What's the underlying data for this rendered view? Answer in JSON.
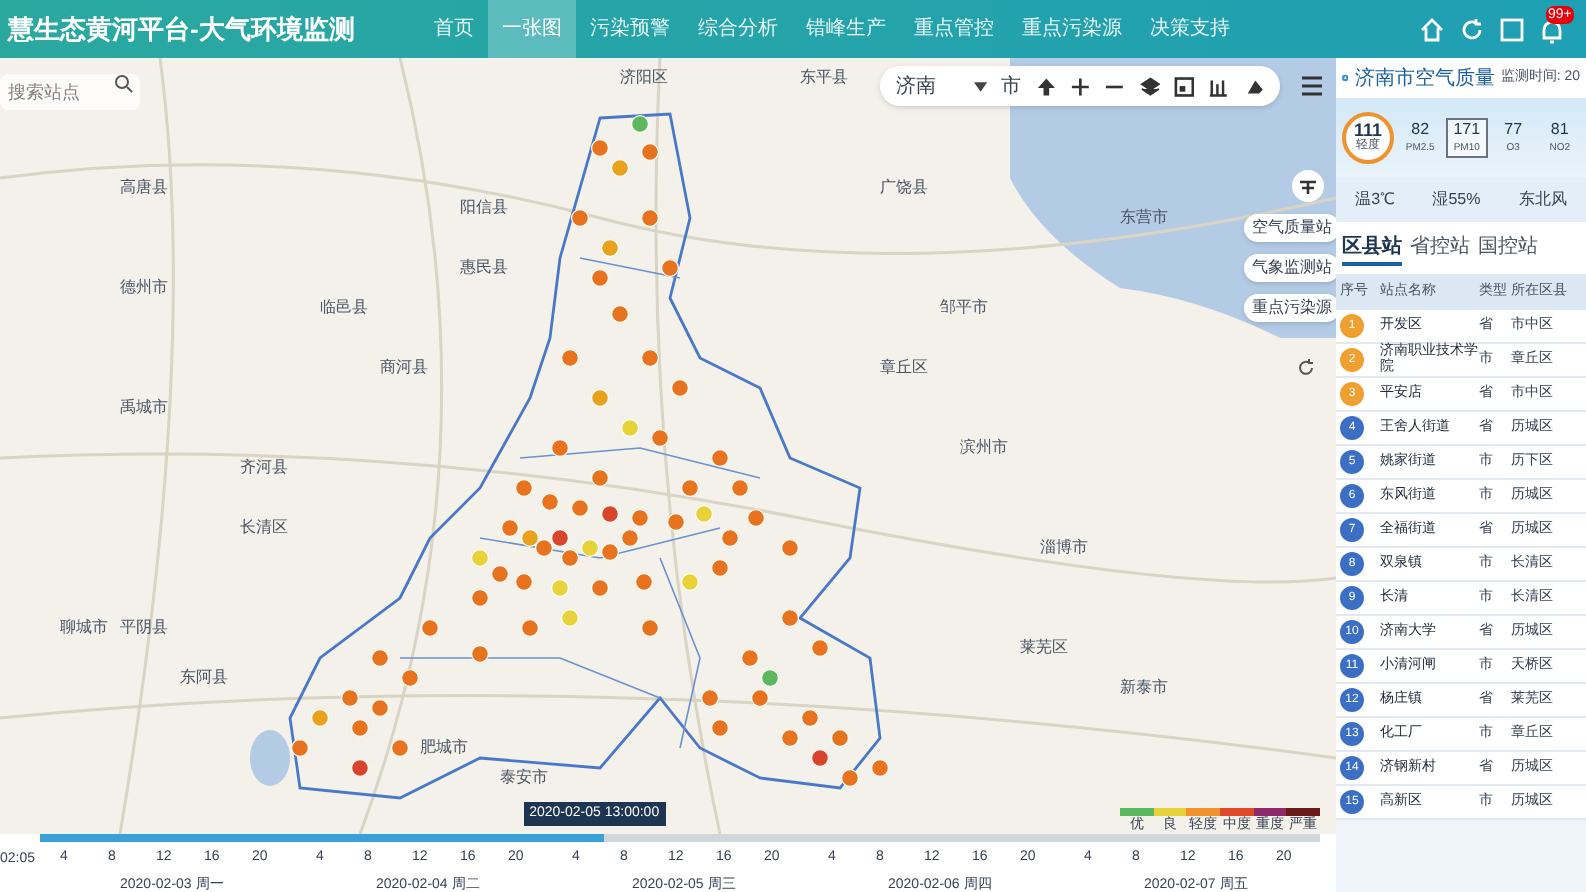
{
  "header": {
    "title": "慧生态黄河平台-大气环境监测",
    "nav": [
      {
        "label": "首页",
        "selected": false
      },
      {
        "label": "一张图",
        "selected": true
      },
      {
        "label": "污染预警",
        "selected": false
      },
      {
        "label": "综合分析",
        "selected": false
      },
      {
        "label": "错峰生产",
        "selected": false
      },
      {
        "label": "重点管控",
        "selected": false
      },
      {
        "label": "重点污染源",
        "selected": false
      },
      {
        "label": "决策支持",
        "selected": false
      }
    ],
    "badge": "99+"
  },
  "map": {
    "search": {
      "placeholder": "搜索站点"
    },
    "city_select": "济南",
    "toolbar_extra": "市",
    "layer_buttons": [
      "空气质量站",
      "气象监测站",
      "重点污染源"
    ],
    "labels": [
      "广饶县",
      "东营市",
      "滨州市",
      "惠民县",
      "阳信县",
      "商河县",
      "济阳区",
      "德州市",
      "齐河县",
      "禹城市",
      "临邑县",
      "章丘区",
      "邹平市",
      "淄博市",
      "长清区",
      "平阴县",
      "东阿县",
      "聊城市",
      "肥城市",
      "泰安市",
      "莱芜区",
      "新泰市",
      "东平县",
      "高唐县"
    ]
  },
  "timeline": {
    "start": "02:05",
    "level": 0.44,
    "tooltip": "2020-02-05 13:00:00",
    "days": [
      {
        "date": "2020-02-03 周一",
        "hours": [
          "4",
          "8",
          "12",
          "16",
          "20"
        ]
      },
      {
        "date": "2020-02-04 周二",
        "hours": [
          "4",
          "8",
          "12",
          "16",
          "20"
        ]
      },
      {
        "date": "2020-02-05 周三",
        "hours": [
          "4",
          "8",
          "12",
          "16",
          "20"
        ]
      },
      {
        "date": "2020-02-06 周四",
        "hours": [
          "4",
          "8",
          "12",
          "16",
          "20"
        ]
      },
      {
        "date": "2020-02-07 周五",
        "hours": [
          "4",
          "8",
          "12",
          "16",
          "20"
        ]
      }
    ],
    "legend": [
      {
        "label": "优",
        "color": "#5cb85c"
      },
      {
        "label": "良",
        "color": "#e8d23a"
      },
      {
        "label": "轻度",
        "color": "#f0922e"
      },
      {
        "label": "中度",
        "color": "#e04a2a"
      },
      {
        "label": "重度",
        "color": "#8e2a6a"
      },
      {
        "label": "严重",
        "color": "#6b1a1a"
      }
    ]
  },
  "panel": {
    "title": "济南市空气质量",
    "time_label": "监测时间: 20",
    "aqi": "111",
    "aqi_level": "轻度",
    "pollutants": [
      {
        "value": "82",
        "name": "PM2.5",
        "selected": false
      },
      {
        "value": "171",
        "name": "PM10",
        "selected": true
      },
      {
        "value": "77",
        "name": "O3",
        "selected": false
      },
      {
        "value": "81",
        "name": "NO2",
        "selected": false
      }
    ],
    "weather": [
      "温3℃",
      "湿55%",
      "东北风"
    ],
    "tabs": [
      {
        "label": "区县站",
        "selected": true
      },
      {
        "label": "省控站",
        "selected": false
      },
      {
        "label": "国控站",
        "selected": false
      }
    ],
    "columns": [
      "序号",
      "站点名称",
      "类型",
      "所在区县"
    ],
    "rows": [
      {
        "rank": "1",
        "color": "#f0a030",
        "name": "开发区",
        "type": "省",
        "district": "市中区"
      },
      {
        "rank": "2",
        "color": "#f0a030",
        "name": "济南职业技术学院",
        "type": "市",
        "district": "章丘区"
      },
      {
        "rank": "3",
        "color": "#f0a030",
        "name": "平安店",
        "type": "省",
        "district": "市中区"
      },
      {
        "rank": "4",
        "color": "#3b6fc4",
        "name": "王舍人街道",
        "type": "省",
        "district": "历城区"
      },
      {
        "rank": "5",
        "color": "#3b6fc4",
        "name": "姚家街道",
        "type": "市",
        "district": "历下区"
      },
      {
        "rank": "6",
        "color": "#3b6fc4",
        "name": "东风街道",
        "type": "市",
        "district": "历城区"
      },
      {
        "rank": "7",
        "color": "#3b6fc4",
        "name": "全福街道",
        "type": "省",
        "district": "历城区"
      },
      {
        "rank": "8",
        "color": "#3b6fc4",
        "name": "双泉镇",
        "type": "市",
        "district": "长清区"
      },
      {
        "rank": "9",
        "color": "#3b6fc4",
        "name": "长清",
        "type": "市",
        "district": "长清区"
      },
      {
        "rank": "10",
        "color": "#3b6fc4",
        "name": "济南大学",
        "type": "省",
        "district": "历城区"
      },
      {
        "rank": "11",
        "color": "#3b6fc4",
        "name": "小清河闸",
        "type": "市",
        "district": "天桥区"
      },
      {
        "rank": "12",
        "color": "#3b6fc4",
        "name": "杨庄镇",
        "type": "省",
        "district": "莱芜区"
      },
      {
        "rank": "13",
        "color": "#3b6fc4",
        "name": "化工厂",
        "type": "市",
        "district": "章丘区"
      },
      {
        "rank": "14",
        "color": "#3b6fc4",
        "name": "济钢新村",
        "type": "省",
        "district": "历城区"
      },
      {
        "rank": "15",
        "color": "#3b6fc4",
        "name": "高新区",
        "type": "市",
        "district": "历城区"
      }
    ]
  }
}
